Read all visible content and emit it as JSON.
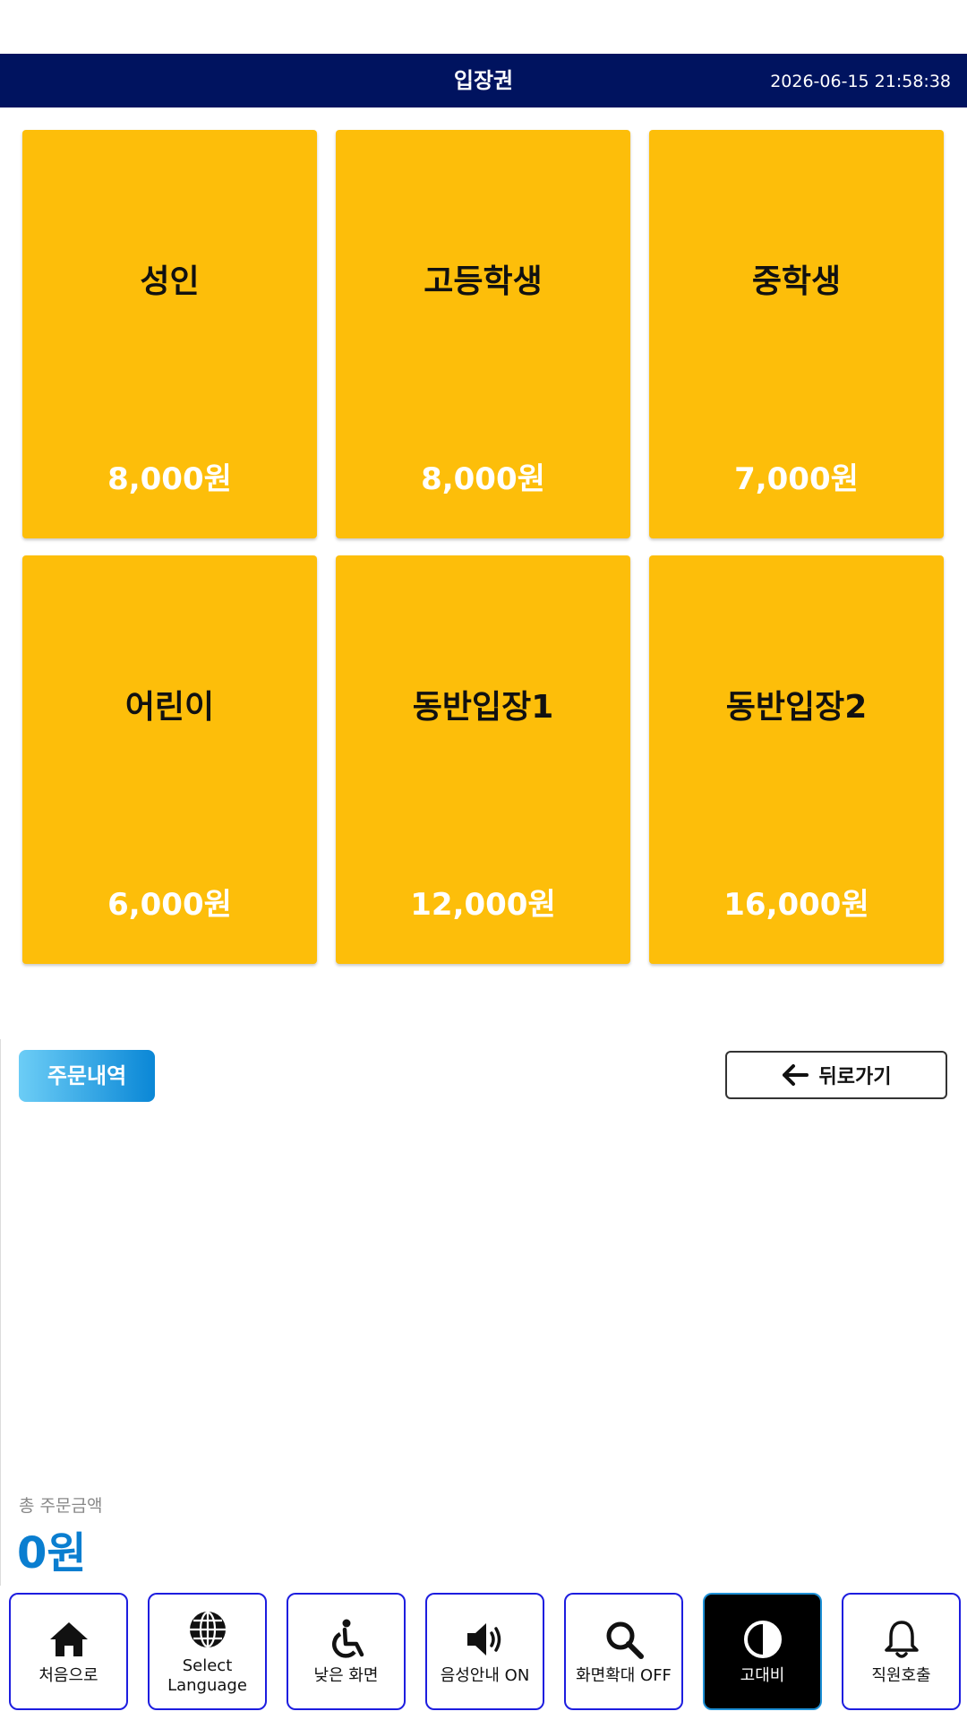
{
  "header": {
    "title": "입장권",
    "datetime": "2026-06-15 21:58:38"
  },
  "tickets": [
    {
      "name": "성인",
      "price": "8,000원"
    },
    {
      "name": "고등학생",
      "price": "8,000원"
    },
    {
      "name": "중학생",
      "price": "7,000원"
    },
    {
      "name": "어린이",
      "price": "6,000원"
    },
    {
      "name": "동반입장1",
      "price": "12,000원"
    },
    {
      "name": "동반입장2",
      "price": "16,000원"
    }
  ],
  "order": {
    "history_label": "주문내역",
    "back_label": "뒤로가기"
  },
  "total": {
    "label": "총 주문금액",
    "amount": "0원"
  },
  "accessibility_bar": [
    {
      "label": "처음으로",
      "icon": "home-icon"
    },
    {
      "label_line1": "Select",
      "label_line2": "Language",
      "icon": "globe-icon"
    },
    {
      "label": "낮은 화면",
      "icon": "wheelchair-icon"
    },
    {
      "label": "음성안내 ON",
      "icon": "speaker-icon"
    },
    {
      "label": "화면확대 OFF",
      "icon": "magnifier-icon"
    },
    {
      "label": "고대비",
      "icon": "contrast-icon",
      "active": true
    },
    {
      "label": "직원호출",
      "icon": "bell-icon"
    }
  ],
  "colors": {
    "header_bg": "#00135f",
    "tile_bg": "#fdbe0a",
    "accent_blue": "#0a7ed0",
    "button_border": "#1d1ddf"
  }
}
